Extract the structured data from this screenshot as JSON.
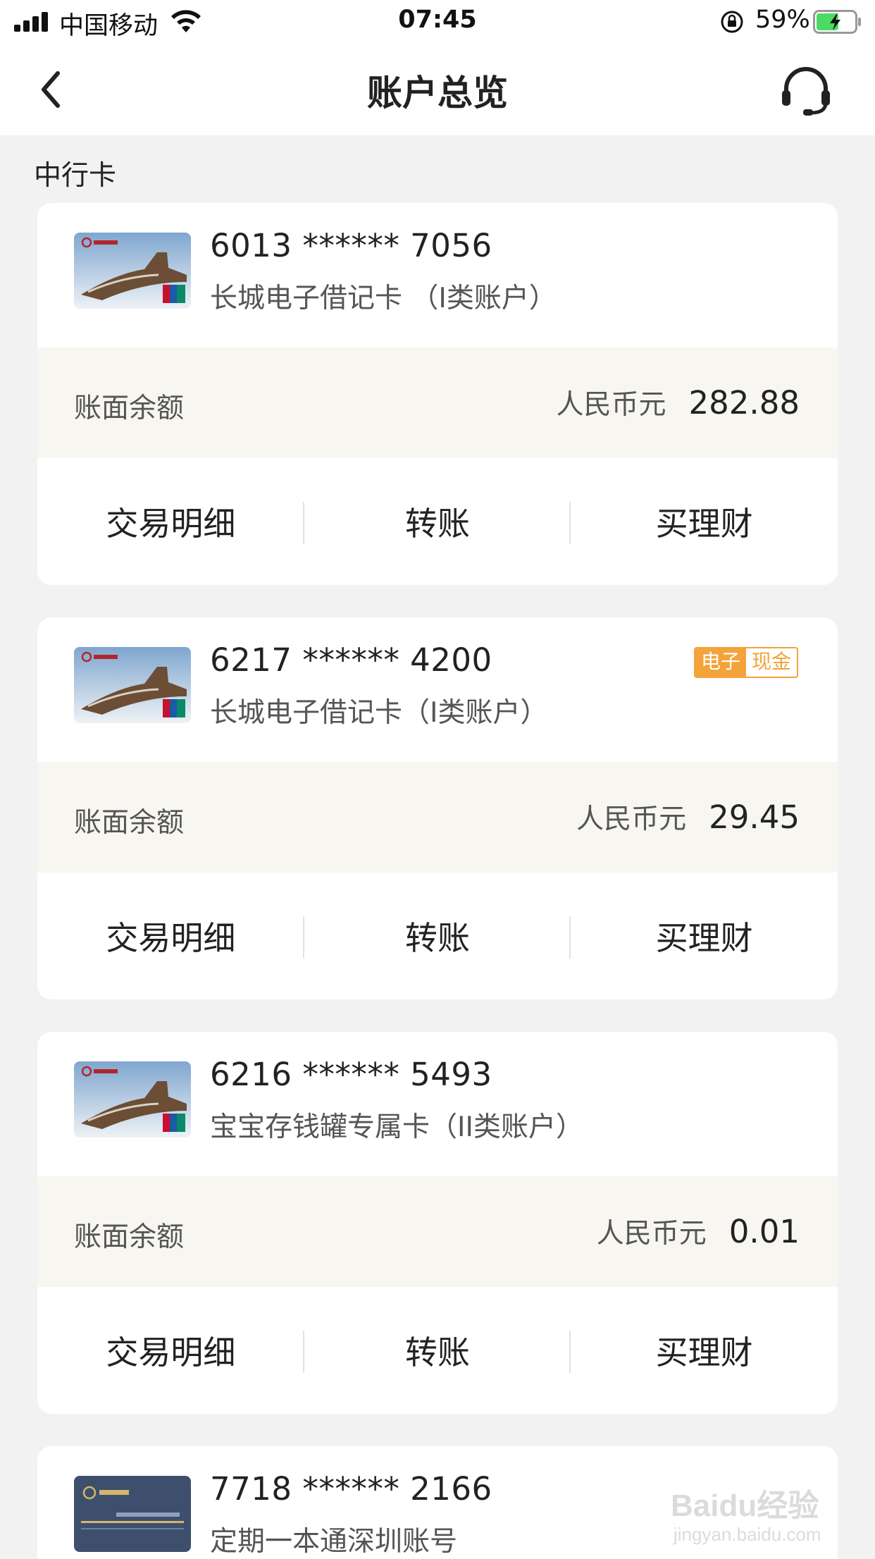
{
  "status_bar": {
    "carrier": "中国移动",
    "time": "07:45",
    "battery_percent": "59%",
    "battery_level": 0.59,
    "icons": [
      "signal-icon",
      "wifi-icon",
      "orientation-lock-icon",
      "battery-charging-icon"
    ]
  },
  "nav": {
    "title": "账户总览",
    "back_icon": "chevron-left-icon",
    "service_icon": "headset-icon"
  },
  "section_title": "中行卡",
  "cards": [
    {
      "number": "6013 ****** 7056",
      "name": "长城电子借记卡 （I类账户）",
      "balance_label": "账面余额",
      "currency": "人民币元",
      "amount": "282.88",
      "actions": [
        "交易明细",
        "转账",
        "买理财"
      ]
    },
    {
      "number": "6217 ****** 4200",
      "name": "长城电子借记卡（I类账户）",
      "tag": {
        "part1": "电子",
        "part2": "现金"
      },
      "balance_label": "账面余额",
      "currency": "人民币元",
      "amount": "29.45",
      "actions": [
        "交易明细",
        "转账",
        "买理财"
      ]
    },
    {
      "number": "6216 ****** 5493",
      "name": "宝宝存钱罐专属卡（II类账户）",
      "balance_label": "账面余额",
      "currency": "人民币元",
      "amount": "0.01",
      "actions": [
        "交易明细",
        "转账",
        "买理财"
      ]
    },
    {
      "number": "7718 ****** 2166",
      "name": "定期一本通深圳账号"
    }
  ],
  "colors": {
    "background": "#f2f2f2",
    "balance_row": "#f8f6f0",
    "tag_orange": "#f3a33a"
  },
  "watermark": {
    "line1": "Baidu经验",
    "line2": "jingyan.baidu.com"
  }
}
